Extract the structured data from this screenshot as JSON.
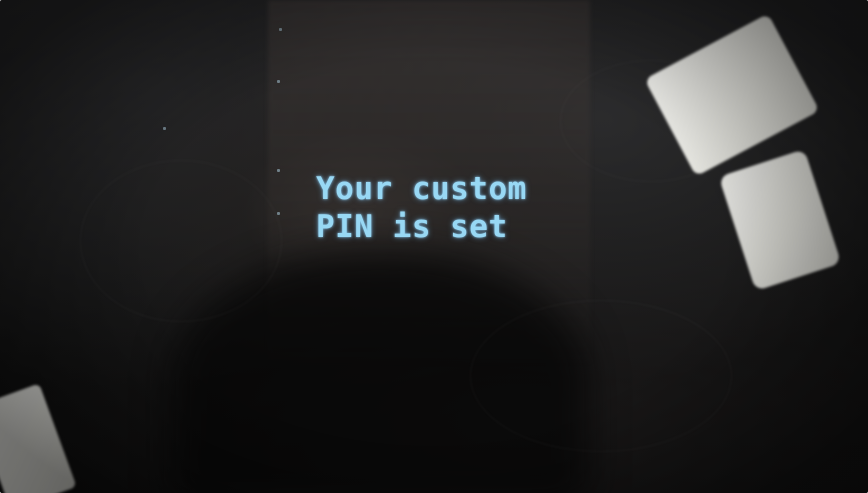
{
  "device_display": {
    "message_lines": [
      "Your custom",
      "PIN is set"
    ],
    "text_color": "#98d8f4",
    "background_color": "#141414"
  }
}
